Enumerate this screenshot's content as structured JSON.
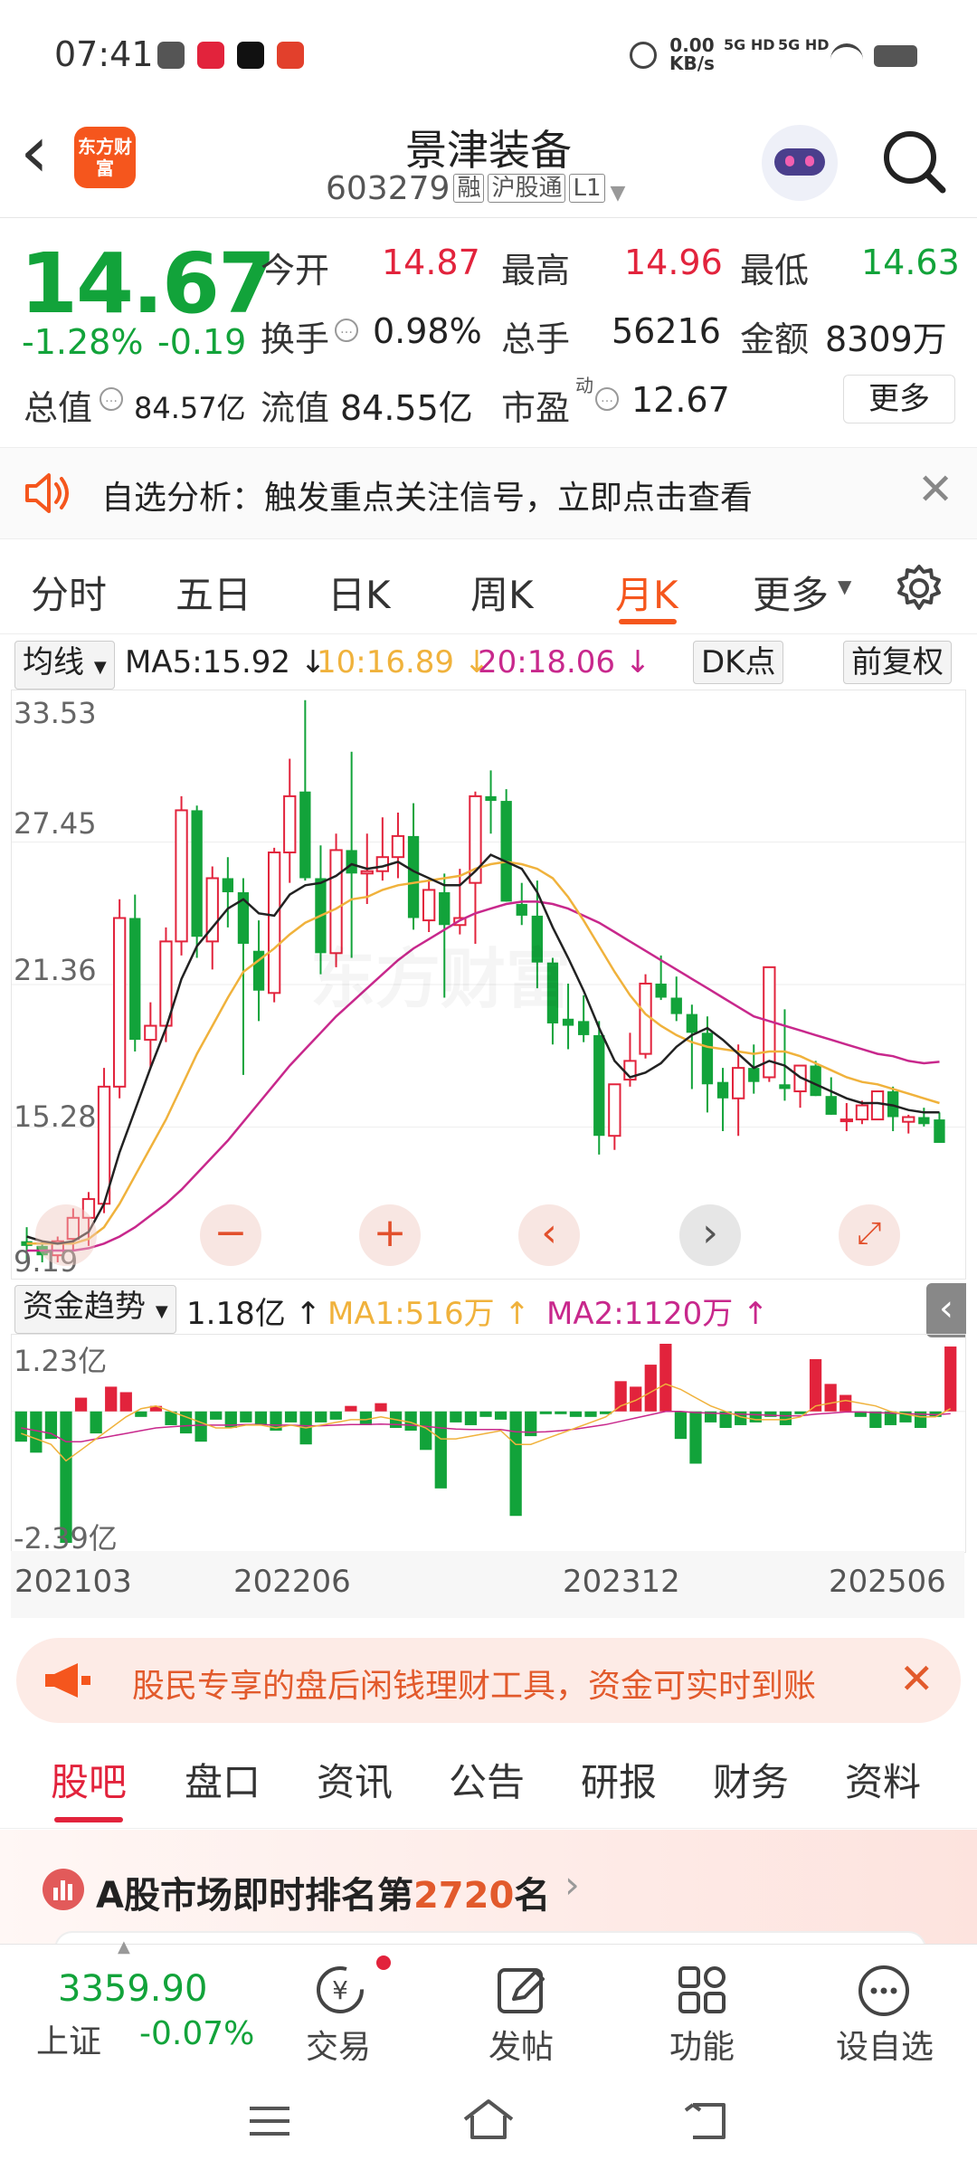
{
  "status_bar": {
    "time": "07:41",
    "net_speed": "0.00",
    "net_unit": "KB/s",
    "sig1": "5G HD",
    "sig2": "5G HD"
  },
  "header": {
    "back": "‹",
    "logo_text": "东方财富",
    "title": "景津装备",
    "code": "603279",
    "tags": [
      "融",
      "沪股通",
      "L1"
    ]
  },
  "quote": {
    "price": "14.67",
    "change_pct": "-1.28%",
    "change": "-0.19",
    "open_label": "今开",
    "open": "14.87",
    "high_label": "最高",
    "high": "14.96",
    "low_label": "最低",
    "low": "14.63",
    "turnover_label": "换手",
    "turnover": "0.98%",
    "volume_label": "总手",
    "volume": "56216",
    "amount_label": "金额",
    "amount": "8309万",
    "mktcap_label": "总值",
    "mktcap": "84.57亿",
    "float_label": "流值",
    "float": "84.55亿",
    "pe_label": "市盈",
    "pe_sup": "动",
    "pe": "12.67",
    "more": "更多"
  },
  "notice": {
    "text": "自选分析：触发重点关注信号，立即点击查看"
  },
  "chart_tabs": [
    "分时",
    "五日",
    "日K",
    "周K",
    "月K",
    "更多"
  ],
  "active_tab": "月K",
  "indicator_bar": {
    "selector": "均线",
    "ma5": "MA5:15.92 ↓",
    "ma10": "10:16.89 ↓",
    "ma20": "20:18.06 ↓",
    "dk": "DK点",
    "fq": "前复权"
  },
  "colors": {
    "up": "#e2233c",
    "down": "#12a33a",
    "ma5": "#222222",
    "ma10": "#f0b23c",
    "ma20": "#c8288c",
    "accent": "#f5561d"
  },
  "watermark": "东方财富",
  "flow_bar": {
    "selector": "资金趋势",
    "value": "1.18亿 ↑",
    "ma1": "MA1:516万 ↑",
    "ma2": "MA2:1120万 ↑"
  },
  "chart_data": [
    {
      "type": "candlestick",
      "y_ticks": [
        "33.53",
        "27.45",
        "21.36",
        "15.28",
        "9.19"
      ],
      "ylim": [
        9.19,
        33.53
      ],
      "x_ticks": [
        "202103",
        "202206",
        "202312",
        "202506"
      ],
      "candles": [
        [
          10.4,
          11.0,
          9.6,
          10.2
        ],
        [
          10.2,
          10.4,
          9.5,
          9.8
        ],
        [
          9.8,
          10.6,
          9.5,
          10.4
        ],
        [
          10.5,
          11.8,
          10.0,
          11.4
        ],
        [
          11.4,
          12.5,
          10.2,
          12.2
        ],
        [
          12.0,
          17.8,
          11.6,
          17.0
        ],
        [
          17.0,
          25.0,
          16.5,
          24.2
        ],
        [
          24.2,
          25.2,
          18.5,
          19.0
        ],
        [
          19.0,
          20.6,
          17.8,
          19.6
        ],
        [
          19.6,
          23.8,
          18.9,
          23.2
        ],
        [
          23.2,
          29.4,
          22.6,
          28.8
        ],
        [
          28.8,
          29.0,
          22.5,
          23.4
        ],
        [
          23.2,
          26.4,
          22.0,
          25.9
        ],
        [
          25.9,
          26.8,
          23.8,
          25.3
        ],
        [
          25.3,
          25.9,
          17.5,
          23.1
        ],
        [
          22.8,
          24.1,
          19.8,
          21.1
        ],
        [
          21.0,
          27.2,
          20.6,
          27.0
        ],
        [
          27.0,
          31.0,
          25.7,
          29.4
        ],
        [
          29.6,
          33.5,
          25.8,
          25.9
        ],
        [
          25.9,
          27.3,
          21.8,
          22.7
        ],
        [
          22.7,
          27.8,
          22.1,
          27.1
        ],
        [
          27.1,
          31.3,
          22.5,
          26.1
        ],
        [
          26.1,
          27.8,
          24.8,
          26.2
        ],
        [
          26.2,
          28.5,
          25.8,
          26.8
        ],
        [
          26.8,
          28.7,
          25.9,
          27.7
        ],
        [
          27.7,
          29.1,
          23.7,
          24.2
        ],
        [
          24.1,
          25.8,
          23.6,
          25.4
        ],
        [
          25.3,
          26.1,
          20.8,
          23.9
        ],
        [
          23.9,
          26.3,
          23.5,
          24.2
        ],
        [
          25.7,
          29.6,
          23.1,
          29.4
        ],
        [
          29.4,
          30.5,
          27.8,
          29.2
        ],
        [
          29.2,
          29.7,
          24.9,
          24.9
        ],
        [
          24.8,
          25.7,
          23.9,
          24.3
        ],
        [
          24.3,
          25.8,
          21.2,
          22.3
        ],
        [
          22.3,
          22.5,
          18.8,
          19.7
        ],
        [
          19.9,
          21.4,
          18.6,
          19.6
        ],
        [
          19.8,
          20.9,
          18.9,
          19.2
        ],
        [
          19.2,
          19.8,
          14.1,
          14.9
        ],
        [
          14.9,
          16.7,
          14.3,
          17.1
        ],
        [
          17.3,
          19.3,
          17.0,
          18.1
        ],
        [
          18.4,
          21.8,
          18.2,
          21.4
        ],
        [
          21.4,
          22.6,
          20.7,
          20.8
        ],
        [
          20.8,
          21.7,
          19.8,
          20.1
        ],
        [
          20.1,
          20.5,
          16.9,
          19.3
        ],
        [
          19.3,
          20.0,
          15.9,
          17.1
        ],
        [
          17.2,
          17.8,
          15.1,
          16.5
        ],
        [
          16.5,
          18.8,
          14.9,
          17.8
        ],
        [
          17.8,
          18.8,
          16.7,
          17.2
        ],
        [
          17.4,
          22.1,
          17.2,
          22.1
        ],
        [
          17.1,
          20.3,
          16.4,
          16.9
        ],
        [
          16.8,
          17.8,
          16.1,
          17.9
        ],
        [
          17.9,
          18.1,
          16.6,
          16.6
        ],
        [
          16.6,
          17.4,
          15.8,
          15.8
        ],
        [
          15.6,
          16.3,
          15.1,
          15.6
        ],
        [
          15.6,
          16.4,
          15.4,
          16.2
        ],
        [
          15.6,
          16.8,
          15.6,
          16.8
        ],
        [
          16.8,
          17.0,
          15.1,
          15.7
        ],
        [
          15.5,
          15.8,
          15.0,
          15.7
        ],
        [
          15.7,
          16.1,
          15.3,
          15.4
        ],
        [
          15.6,
          15.9,
          14.8,
          14.6
        ]
      ],
      "ma5": [
        10.6,
        10.4,
        10.3,
        10.4,
        10.8,
        12.0,
        14.2,
        16.0,
        17.8,
        19.5,
        21.6,
        23.0,
        23.8,
        24.6,
        25.0,
        24.4,
        24.3,
        25.2,
        25.6,
        25.7,
        26.0,
        26.5,
        26.3,
        26.4,
        26.6,
        26.2,
        25.9,
        25.6,
        25.6,
        26.2,
        26.9,
        26.6,
        26.3,
        25.3,
        23.8,
        22.5,
        21.1,
        19.5,
        18.1,
        17.4,
        17.6,
        18.0,
        18.7,
        19.2,
        19.5,
        19.0,
        18.4,
        17.8,
        18.1,
        17.9,
        17.4,
        17.1,
        16.8,
        16.5,
        16.3,
        16.3,
        16.2,
        16.0,
        15.9,
        15.9
      ],
      "ma10": [
        10.3,
        10.3,
        10.3,
        10.3,
        10.5,
        11.0,
        12.0,
        13.2,
        14.4,
        15.6,
        17.0,
        18.4,
        19.6,
        20.8,
        21.9,
        22.4,
        22.9,
        23.5,
        24.0,
        24.3,
        24.6,
        25.0,
        25.1,
        25.4,
        25.6,
        25.7,
        25.8,
        25.9,
        26.0,
        26.3,
        26.5,
        26.6,
        26.5,
        26.3,
        25.9,
        25.1,
        24.1,
        23.0,
        21.9,
        20.9,
        20.1,
        19.6,
        19.2,
        18.9,
        18.7,
        18.6,
        18.5,
        18.4,
        18.5,
        18.5,
        18.3,
        18.0,
        17.7,
        17.4,
        17.2,
        17.1,
        16.9,
        16.7,
        16.5,
        16.3
      ],
      "ma20": [
        10.0,
        10.0,
        10.0,
        10.0,
        10.1,
        10.3,
        10.6,
        11.0,
        11.5,
        12.0,
        12.6,
        13.3,
        14.0,
        14.7,
        15.5,
        16.3,
        17.1,
        17.9,
        18.6,
        19.3,
        20.0,
        20.6,
        21.2,
        21.8,
        22.4,
        22.9,
        23.3,
        23.7,
        24.1,
        24.4,
        24.6,
        24.8,
        24.9,
        24.9,
        24.8,
        24.6,
        24.3,
        24.0,
        23.6,
        23.2,
        22.8,
        22.4,
        22.0,
        21.6,
        21.2,
        20.8,
        20.4,
        20.0,
        19.8,
        19.6,
        19.4,
        19.2,
        19.0,
        18.8,
        18.6,
        18.4,
        18.3,
        18.1,
        18.0,
        18.06
      ]
    },
    {
      "type": "bar",
      "y_ticks": [
        "1.23亿",
        "-2.39亿"
      ],
      "ylim": [
        -2.39,
        1.23
      ],
      "values": [
        -0.55,
        -0.75,
        -0.5,
        -2.39,
        0.25,
        -0.4,
        0.45,
        0.35,
        -0.1,
        0.1,
        -0.25,
        -0.4,
        -0.55,
        -0.15,
        -0.3,
        -0.2,
        -0.25,
        -0.35,
        -0.2,
        -0.6,
        -0.2,
        -0.15,
        0.1,
        -0.25,
        0.15,
        -0.3,
        -0.35,
        -0.7,
        -1.4,
        -0.2,
        -0.25,
        -0.1,
        -0.15,
        -1.9,
        -0.45,
        -0.05,
        -0.05,
        -0.1,
        -0.1,
        -0.05,
        0.55,
        0.45,
        0.85,
        1.23,
        -0.5,
        -0.95,
        -0.2,
        -0.3,
        -0.25,
        -0.2,
        -0.1,
        -0.25,
        -0.05,
        0.95,
        0.5,
        0.3,
        -0.1,
        -0.3,
        -0.25,
        -0.2,
        -0.3,
        -0.1,
        1.18
      ],
      "ma1": [
        -0.4,
        -0.5,
        -0.6,
        -0.9,
        -0.7,
        -0.5,
        -0.3,
        -0.1,
        0.05,
        0.1,
        0.0,
        -0.1,
        -0.2,
        -0.3,
        -0.3,
        -0.25,
        -0.25,
        -0.3,
        -0.25,
        -0.3,
        -0.25,
        -0.2,
        -0.15,
        -0.15,
        -0.1,
        -0.15,
        -0.2,
        -0.3,
        -0.5,
        -0.5,
        -0.45,
        -0.4,
        -0.35,
        -0.6,
        -0.6,
        -0.5,
        -0.4,
        -0.3,
        -0.2,
        -0.1,
        0.1,
        0.2,
        0.35,
        0.5,
        0.4,
        0.25,
        0.1,
        0.0,
        -0.1,
        -0.15,
        -0.15,
        -0.15,
        -0.1,
        0.1,
        0.15,
        0.2,
        0.15,
        0.1,
        0.0,
        -0.05,
        -0.1,
        -0.1,
        0.05
      ],
      "ma2": [
        -0.3,
        -0.35,
        -0.4,
        -0.55,
        -0.55,
        -0.5,
        -0.45,
        -0.4,
        -0.35,
        -0.3,
        -0.28,
        -0.26,
        -0.25,
        -0.25,
        -0.25,
        -0.24,
        -0.24,
        -0.25,
        -0.25,
        -0.26,
        -0.26,
        -0.25,
        -0.24,
        -0.24,
        -0.23,
        -0.24,
        -0.25,
        -0.27,
        -0.3,
        -0.32,
        -0.33,
        -0.33,
        -0.33,
        -0.37,
        -0.38,
        -0.37,
        -0.35,
        -0.32,
        -0.28,
        -0.24,
        -0.18,
        -0.12,
        -0.06,
        0.0,
        0.0,
        -0.02,
        -0.03,
        -0.04,
        -0.05,
        -0.06,
        -0.07,
        -0.08,
        -0.08,
        -0.05,
        -0.03,
        -0.01,
        -0.01,
        -0.02,
        -0.03,
        -0.04,
        -0.05,
        -0.06,
        -0.04
      ]
    }
  ],
  "marquee": {
    "text": "股民专享的盘后闲钱理财工具，资金可实时到账"
  },
  "bottom_tabs": [
    "股吧",
    "盘口",
    "资讯",
    "公告",
    "研报",
    "财务",
    "资料"
  ],
  "rank": {
    "prefix": "A股市场即时排名第",
    "num": "2720",
    "suffix": "名"
  },
  "index": {
    "value": "3359.90",
    "name": "上证",
    "change": "-0.07%"
  },
  "nav": [
    "交易",
    "发帖",
    "功能",
    "设自选"
  ]
}
